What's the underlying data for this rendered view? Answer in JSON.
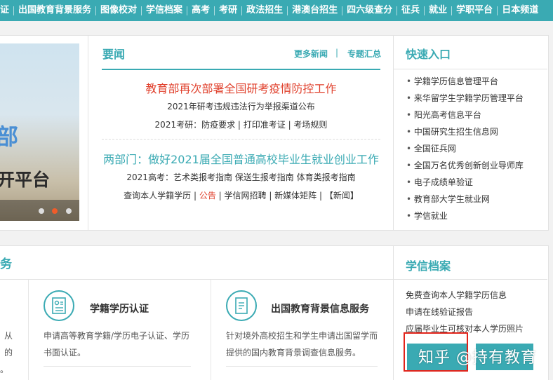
{
  "topnav": {
    "items": [
      "证",
      "出国教育背景服务",
      "图像校对",
      "学信档案",
      "高考",
      "考研",
      "政法招生",
      "港澳台招生",
      "四六级查分",
      "征兵",
      "就业",
      "学职平台",
      "日本频道"
    ]
  },
  "banner": {
    "text1": "部",
    "text2": "开平台"
  },
  "news": {
    "title": "要闻",
    "more": "更多新闻",
    "divider": "|",
    "summary": "专题汇总",
    "headline1": "教育部再次部署全国研考疫情防控工作",
    "sub1": "2021年研考违规违法行为举报渠道公布",
    "sub2": "2021考研：防疫要求 | 打印准考证 | 考场规则",
    "headline2": "两部门：做好2021届全国普通高校毕业生就业创业工作",
    "sub3": "2021高考：艺术类报考指南 保送生报考指南 体育类报考指南",
    "sub4_a": "查询本人学籍学历 | ",
    "sub4_b": "公告",
    "sub4_c": " | 学信网招聘 | 新媒体矩阵 | 【新闻】"
  },
  "quick": {
    "title": "快速入口",
    "items": [
      "学籍学历信息管理平台",
      "来华留学生学籍学历管理平台",
      "阳光高考信息平台",
      "中国研究生招生信息网",
      "全国征兵网",
      "全国万名优秀创新创业导师库",
      "电子成绩单验证",
      "教育部大学生就业网",
      "学信就业"
    ]
  },
  "services": {
    "head": "务",
    "left_desc1": "从的",
    "left_desc2": "。",
    "card1_title": "学籍学历认证",
    "card1_desc1": "申请高等教育学籍/学历电子认证、学历",
    "card1_desc2": "书面认证。",
    "card2_title": "出国教育背景信息服务",
    "card2_desc1": "针对境外高校招生和学生申请出国留学而",
    "card2_desc2": "提供的国内教育背景调查信息服务。"
  },
  "archive": {
    "title": "学信档案",
    "items": [
      "免费查询本人学籍学历信息",
      "申请在线验证报告",
      "应届毕业生可核对本人学历照片"
    ],
    "btn1": "",
    "btn2": ""
  },
  "watermark": "知乎 @持有教育",
  "colors": {
    "accent": "#3aaab3",
    "red": "#e0412d",
    "highlight": "#e2231a"
  }
}
